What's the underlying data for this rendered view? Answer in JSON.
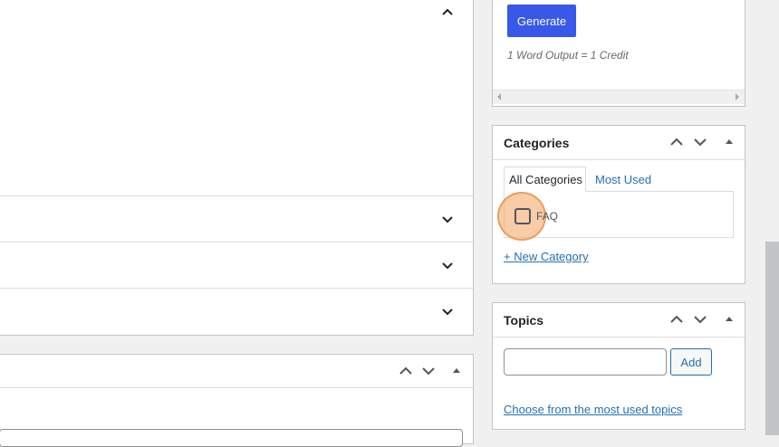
{
  "generator": {
    "generate_label": "Generate",
    "credit_note": "1 Word Output = 1 Credit"
  },
  "categories": {
    "title": "Categories",
    "tabs": [
      "All Categories",
      "Most Used"
    ],
    "items": [
      {
        "label": "FAQ",
        "checked": false
      }
    ],
    "add_new_label": "+ New Category"
  },
  "topics": {
    "title": "Topics",
    "input_value": "",
    "add_label": "Add",
    "choose_label": "Choose from the most used topics"
  },
  "colors": {
    "accent": "#3858e9",
    "link": "#2271b1",
    "highlight": "#f0a35e"
  },
  "icons": [
    "chevron-up-icon",
    "chevron-down-icon",
    "triangle-up-icon"
  ]
}
